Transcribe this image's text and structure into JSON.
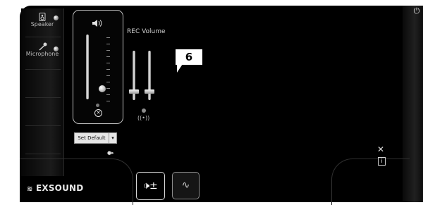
{
  "sidebar": {
    "speaker_label": "Speaker",
    "microphone_label": "Microphone"
  },
  "volume_panel": {
    "speaker_icon": "speaker-icon",
    "mute_icon": "mute-icon",
    "set_default_label": "Set Default",
    "dropdown_glyph": "▾",
    "arrows_glyph": "●▸"
  },
  "rec": {
    "title": "REC Volume",
    "rec_icon_text": "((•))"
  },
  "callout": {
    "number": "6"
  },
  "footer": {
    "logo_text": "EXSOUND",
    "volume_button_glyph": "🕩±",
    "eq_button_glyph": "∿"
  },
  "icons": {
    "power": "power-icon",
    "tools": "tools-icon",
    "info": "info-icon"
  },
  "colors": {
    "background": "#000000",
    "panel_border": "#bdbdbd",
    "text": "#bdbdbd"
  }
}
